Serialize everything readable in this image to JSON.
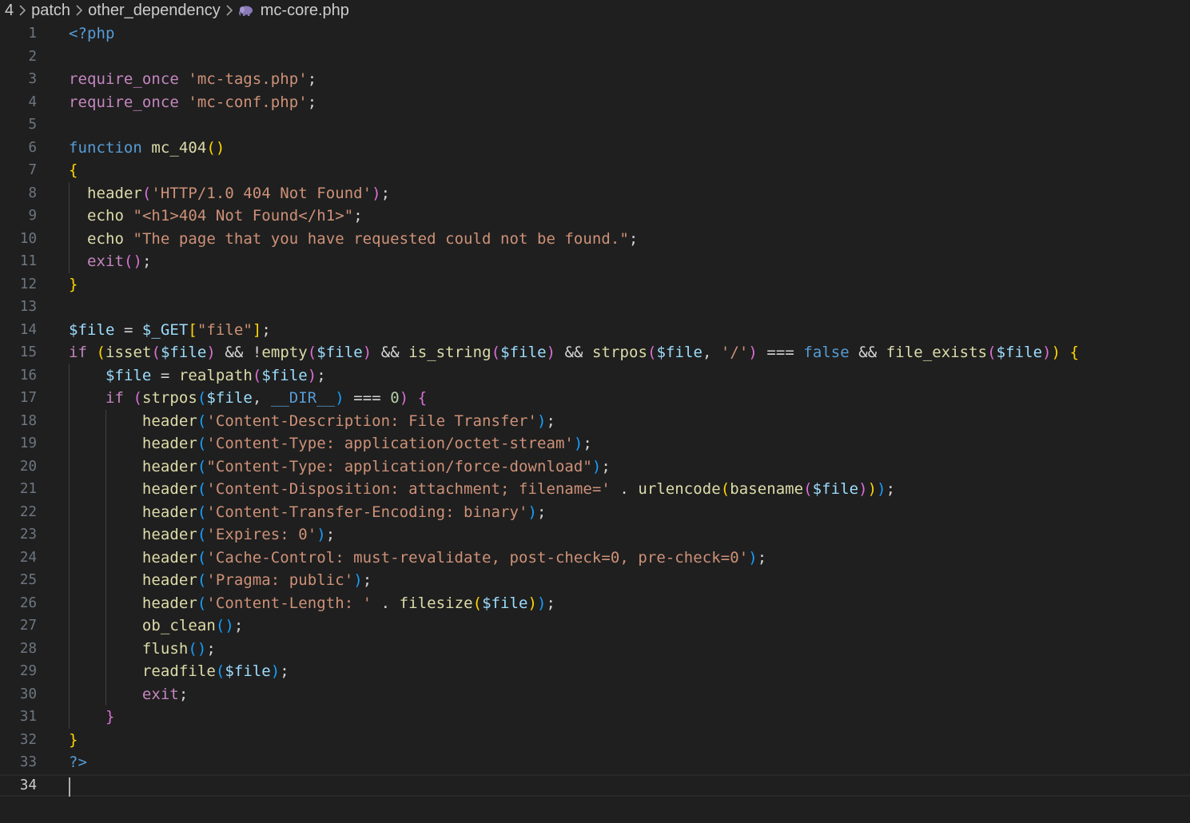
{
  "breadcrumb": {
    "items": [
      "4",
      "patch",
      "other_dependency",
      "mc-core.php"
    ],
    "file_icon": "php-elephant-icon"
  },
  "editor": {
    "language": "php",
    "current_line": 34,
    "colors": {
      "background": "#1f1f1f",
      "keyword": "#569cd6",
      "control": "#c586c0",
      "function": "#dcdcaa",
      "string": "#ce9178",
      "variable": "#9cdcfe",
      "number": "#b5cea8",
      "bracket1": "#ffd700",
      "bracket2": "#da70d6",
      "bracket3": "#179fff"
    },
    "lines": [
      {
        "n": "1",
        "indent": 0,
        "tokens": [
          [
            "kw",
            "<?php"
          ]
        ]
      },
      {
        "n": "2",
        "indent": 0,
        "tokens": []
      },
      {
        "n": "3",
        "indent": 0,
        "tokens": [
          [
            "ctrl",
            "require_once"
          ],
          [
            "p",
            " "
          ],
          [
            "str",
            "'mc-tags.php'"
          ],
          [
            "p",
            ";"
          ]
        ]
      },
      {
        "n": "4",
        "indent": 0,
        "tokens": [
          [
            "ctrl",
            "require_once"
          ],
          [
            "p",
            " "
          ],
          [
            "str",
            "'mc-conf.php'"
          ],
          [
            "p",
            ";"
          ]
        ]
      },
      {
        "n": "5",
        "indent": 0,
        "tokens": []
      },
      {
        "n": "6",
        "indent": 0,
        "tokens": [
          [
            "kw",
            "function"
          ],
          [
            "p",
            " "
          ],
          [
            "fn",
            "mc_404"
          ],
          [
            "b1",
            "()"
          ]
        ]
      },
      {
        "n": "7",
        "indent": 0,
        "tokens": [
          [
            "b1",
            "{"
          ]
        ]
      },
      {
        "n": "8",
        "indent": 1,
        "tokens": [
          [
            "p",
            "  "
          ],
          [
            "fn",
            "header"
          ],
          [
            "b2",
            "("
          ],
          [
            "str",
            "'HTTP/1.0 404 Not Found'"
          ],
          [
            "b2",
            ")"
          ],
          [
            "p",
            ";"
          ]
        ]
      },
      {
        "n": "9",
        "indent": 1,
        "tokens": [
          [
            "p",
            "  "
          ],
          [
            "fn",
            "echo"
          ],
          [
            "p",
            " "
          ],
          [
            "str",
            "\"<h1>404 Not Found</h1>\""
          ],
          [
            "p",
            ";"
          ]
        ]
      },
      {
        "n": "10",
        "indent": 1,
        "tokens": [
          [
            "p",
            "  "
          ],
          [
            "fn",
            "echo"
          ],
          [
            "p",
            " "
          ],
          [
            "str",
            "\"The page that you have requested could not be found.\""
          ],
          [
            "p",
            ";"
          ]
        ]
      },
      {
        "n": "11",
        "indent": 1,
        "tokens": [
          [
            "p",
            "  "
          ],
          [
            "ctrl",
            "exit"
          ],
          [
            "b2",
            "()"
          ],
          [
            "p",
            ";"
          ]
        ]
      },
      {
        "n": "12",
        "indent": 0,
        "tokens": [
          [
            "b1",
            "}"
          ]
        ]
      },
      {
        "n": "13",
        "indent": 0,
        "tokens": []
      },
      {
        "n": "14",
        "indent": 0,
        "tokens": [
          [
            "var",
            "$file"
          ],
          [
            "p",
            " = "
          ],
          [
            "var",
            "$_GET"
          ],
          [
            "b1",
            "["
          ],
          [
            "str",
            "\"file\""
          ],
          [
            "b1",
            "]"
          ],
          [
            "p",
            ";"
          ]
        ]
      },
      {
        "n": "15",
        "indent": 0,
        "tokens": [
          [
            "ctrl",
            "if"
          ],
          [
            "p",
            " "
          ],
          [
            "b1",
            "("
          ],
          [
            "fn",
            "isset"
          ],
          [
            "b2",
            "("
          ],
          [
            "var",
            "$file"
          ],
          [
            "b2",
            ")"
          ],
          [
            "p",
            " && !"
          ],
          [
            "fn",
            "empty"
          ],
          [
            "b2",
            "("
          ],
          [
            "var",
            "$file"
          ],
          [
            "b2",
            ")"
          ],
          [
            "p",
            " && "
          ],
          [
            "fn",
            "is_string"
          ],
          [
            "b2",
            "("
          ],
          [
            "var",
            "$file"
          ],
          [
            "b2",
            ")"
          ],
          [
            "p",
            " && "
          ],
          [
            "fn",
            "strpos"
          ],
          [
            "b2",
            "("
          ],
          [
            "var",
            "$file"
          ],
          [
            "p",
            ", "
          ],
          [
            "str",
            "'/'"
          ],
          [
            "b2",
            ")"
          ],
          [
            "p",
            " === "
          ],
          [
            "kw",
            "false"
          ],
          [
            "p",
            " && "
          ],
          [
            "fn",
            "file_exists"
          ],
          [
            "b2",
            "("
          ],
          [
            "var",
            "$file"
          ],
          [
            "b2",
            ")"
          ],
          [
            "b1",
            ")"
          ],
          [
            "p",
            " "
          ],
          [
            "b1",
            "{"
          ]
        ]
      },
      {
        "n": "16",
        "indent": 1,
        "tokens": [
          [
            "p",
            "    "
          ],
          [
            "var",
            "$file"
          ],
          [
            "p",
            " = "
          ],
          [
            "fn",
            "realpath"
          ],
          [
            "b2",
            "("
          ],
          [
            "var",
            "$file"
          ],
          [
            "b2",
            ")"
          ],
          [
            "p",
            ";"
          ]
        ]
      },
      {
        "n": "17",
        "indent": 1,
        "tokens": [
          [
            "p",
            "    "
          ],
          [
            "ctrl",
            "if"
          ],
          [
            "p",
            " "
          ],
          [
            "b2",
            "("
          ],
          [
            "fn",
            "strpos"
          ],
          [
            "b3",
            "("
          ],
          [
            "var",
            "$file"
          ],
          [
            "p",
            ", "
          ],
          [
            "kw",
            "__DIR__"
          ],
          [
            "b3",
            ")"
          ],
          [
            "p",
            " === "
          ],
          [
            "num",
            "0"
          ],
          [
            "b2",
            ")"
          ],
          [
            "p",
            " "
          ],
          [
            "b2",
            "{"
          ]
        ]
      },
      {
        "n": "18",
        "indent": 2,
        "tokens": [
          [
            "p",
            "        "
          ],
          [
            "fn",
            "header"
          ],
          [
            "b3",
            "("
          ],
          [
            "str",
            "'Content-Description: File Transfer'"
          ],
          [
            "b3",
            ")"
          ],
          [
            "p",
            ";"
          ]
        ]
      },
      {
        "n": "19",
        "indent": 2,
        "tokens": [
          [
            "p",
            "        "
          ],
          [
            "fn",
            "header"
          ],
          [
            "b3",
            "("
          ],
          [
            "str",
            "'Content-Type: application/octet-stream'"
          ],
          [
            "b3",
            ")"
          ],
          [
            "p",
            ";"
          ]
        ]
      },
      {
        "n": "20",
        "indent": 2,
        "tokens": [
          [
            "p",
            "        "
          ],
          [
            "fn",
            "header"
          ],
          [
            "b3",
            "("
          ],
          [
            "str",
            "\"Content-Type: application/force-download\""
          ],
          [
            "b3",
            ")"
          ],
          [
            "p",
            ";"
          ]
        ]
      },
      {
        "n": "21",
        "indent": 2,
        "tokens": [
          [
            "p",
            "        "
          ],
          [
            "fn",
            "header"
          ],
          [
            "b3",
            "("
          ],
          [
            "str",
            "'Content-Disposition: attachment; filename='"
          ],
          [
            "p",
            " . "
          ],
          [
            "fn",
            "urlencode"
          ],
          [
            "b1",
            "("
          ],
          [
            "fn",
            "basename"
          ],
          [
            "b2",
            "("
          ],
          [
            "var",
            "$file"
          ],
          [
            "b2",
            ")"
          ],
          [
            "b1",
            ")"
          ],
          [
            "b3",
            ")"
          ],
          [
            "p",
            ";"
          ]
        ]
      },
      {
        "n": "22",
        "indent": 2,
        "tokens": [
          [
            "p",
            "        "
          ],
          [
            "fn",
            "header"
          ],
          [
            "b3",
            "("
          ],
          [
            "str",
            "'Content-Transfer-Encoding: binary'"
          ],
          [
            "b3",
            ")"
          ],
          [
            "p",
            ";"
          ]
        ]
      },
      {
        "n": "23",
        "indent": 2,
        "tokens": [
          [
            "p",
            "        "
          ],
          [
            "fn",
            "header"
          ],
          [
            "b3",
            "("
          ],
          [
            "str",
            "'Expires: 0'"
          ],
          [
            "b3",
            ")"
          ],
          [
            "p",
            ";"
          ]
        ]
      },
      {
        "n": "24",
        "indent": 2,
        "tokens": [
          [
            "p",
            "        "
          ],
          [
            "fn",
            "header"
          ],
          [
            "b3",
            "("
          ],
          [
            "str",
            "'Cache-Control: must-revalidate, post-check=0, pre-check=0'"
          ],
          [
            "b3",
            ")"
          ],
          [
            "p",
            ";"
          ]
        ]
      },
      {
        "n": "25",
        "indent": 2,
        "tokens": [
          [
            "p",
            "        "
          ],
          [
            "fn",
            "header"
          ],
          [
            "b3",
            "("
          ],
          [
            "str",
            "'Pragma: public'"
          ],
          [
            "b3",
            ")"
          ],
          [
            "p",
            ";"
          ]
        ]
      },
      {
        "n": "26",
        "indent": 2,
        "tokens": [
          [
            "p",
            "        "
          ],
          [
            "fn",
            "header"
          ],
          [
            "b3",
            "("
          ],
          [
            "str",
            "'Content-Length: '"
          ],
          [
            "p",
            " . "
          ],
          [
            "fn",
            "filesize"
          ],
          [
            "b1",
            "("
          ],
          [
            "var",
            "$file"
          ],
          [
            "b1",
            ")"
          ],
          [
            "b3",
            ")"
          ],
          [
            "p",
            ";"
          ]
        ]
      },
      {
        "n": "27",
        "indent": 2,
        "tokens": [
          [
            "p",
            "        "
          ],
          [
            "fn",
            "ob_clean"
          ],
          [
            "b3",
            "()"
          ],
          [
            "p",
            ";"
          ]
        ]
      },
      {
        "n": "28",
        "indent": 2,
        "tokens": [
          [
            "p",
            "        "
          ],
          [
            "fn",
            "flush"
          ],
          [
            "b3",
            "()"
          ],
          [
            "p",
            ";"
          ]
        ]
      },
      {
        "n": "29",
        "indent": 2,
        "tokens": [
          [
            "p",
            "        "
          ],
          [
            "fn",
            "readfile"
          ],
          [
            "b3",
            "("
          ],
          [
            "var",
            "$file"
          ],
          [
            "b3",
            ")"
          ],
          [
            "p",
            ";"
          ]
        ]
      },
      {
        "n": "30",
        "indent": 2,
        "tokens": [
          [
            "p",
            "        "
          ],
          [
            "ctrl",
            "exit"
          ],
          [
            "p",
            ";"
          ]
        ]
      },
      {
        "n": "31",
        "indent": 1,
        "tokens": [
          [
            "p",
            "    "
          ],
          [
            "b2",
            "}"
          ]
        ]
      },
      {
        "n": "32",
        "indent": 0,
        "tokens": [
          [
            "b1",
            "}"
          ]
        ]
      },
      {
        "n": "33",
        "indent": 0,
        "tokens": [
          [
            "kw",
            "?>"
          ]
        ]
      },
      {
        "n": "34",
        "indent": 0,
        "tokens": []
      }
    ]
  }
}
